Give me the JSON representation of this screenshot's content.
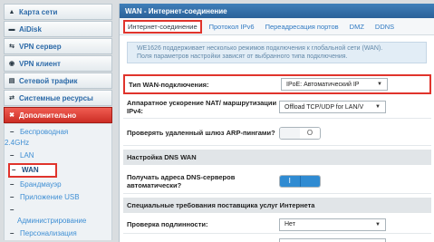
{
  "sidebar": {
    "items": [
      {
        "label": "Карта сети",
        "icon": "home-icon"
      },
      {
        "label": "AiDisk",
        "icon": "disk-icon"
      },
      {
        "label": "VPN сервер",
        "icon": "vpn-server-icon"
      },
      {
        "label": "VPN клиент",
        "icon": "vpn-client-icon"
      },
      {
        "label": "Сетевой трафик",
        "icon": "traffic-icon"
      },
      {
        "label": "Системные ресурсы",
        "icon": "resources-icon"
      },
      {
        "label": "Дополнительно",
        "icon": "wrench-icon"
      }
    ],
    "sub_items": {
      "wireless_a": "Беспроводная",
      "wireless_b": "2.4GHz",
      "lan": "LAN",
      "wan": "WAN",
      "firewall": "Брандмауэр",
      "usb": "Приложение USB",
      "admin": "Администрирование",
      "personalize": "Персонализация"
    }
  },
  "main": {
    "title": "WAN - Интернет-соединение",
    "tabs": [
      "Интернет-соединение",
      "Протокол IPv6",
      "Переадресация портов",
      "DMZ",
      "DDNS"
    ],
    "info_line1": "WE1626 поддерживает несколько режимов подключения к глобальной сети (WAN).",
    "info_line2": "Поля параметров настройки зависят от выбранного типа подключения.",
    "wan_type_label": "Тип WAN-подключения:",
    "wan_type_value": "IPoE: Автоматический IP",
    "nat_label": "Аппаратное ускорение NAT/ маршрутизации IPv4:",
    "nat_value": "Offload TCP/UDP for LAN/V",
    "arp_label": "Проверять удаленный шлюз ARP-пингами?",
    "arp_toggle": "O",
    "dns_section": "Настройка DNS WAN",
    "dns_label": "Получать адреса DNS-серверов автоматически?",
    "dns_toggle": "I",
    "isp_section": "Специальные требования поставщика услуг Интернета",
    "auth_label": "Проверка подлинности:",
    "auth_value": "Нет"
  },
  "colors": {
    "accent_red": "#e0342c",
    "header_blue": "#2b6199",
    "link_blue": "#2f79c2"
  }
}
